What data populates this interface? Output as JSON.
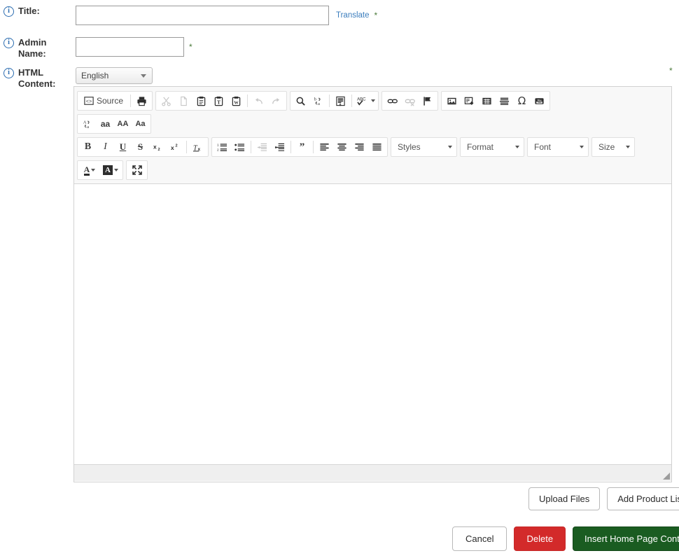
{
  "form": {
    "rows": [
      {
        "id": "title",
        "label": "Title:",
        "icon": "info-icon",
        "value": "",
        "placeholder": "",
        "required_marker": "*",
        "translate_label": "Translate"
      },
      {
        "id": "admin_name",
        "label": "Admin Name:",
        "icon": "info-icon",
        "value": "",
        "placeholder": "",
        "required_marker": "*"
      },
      {
        "id": "html_content",
        "label": "HTML Content:",
        "icon": "info-icon",
        "required_marker": "*"
      }
    ],
    "language_select": {
      "value": "English",
      "options": [
        "English"
      ]
    }
  },
  "editor": {
    "toolbar_rows": [
      {
        "groups": [
          {
            "items": [
              {
                "name": "source-button",
                "icon": "source-icon",
                "label": "Source",
                "disabled": false
              },
              {
                "name": "separator",
                "icon": "separator"
              },
              {
                "name": "print-button",
                "icon": "printer-icon",
                "disabled": false
              }
            ]
          },
          {
            "items": [
              {
                "name": "cut-button",
                "icon": "scissors-icon",
                "disabled": true
              },
              {
                "name": "copy-button",
                "icon": "copy-icon",
                "disabled": true
              },
              {
                "name": "paste-button",
                "icon": "paste-icon",
                "disabled": false
              },
              {
                "name": "paste-as-plain-text-button",
                "icon": "paste-text-icon",
                "disabled": false
              },
              {
                "name": "paste-from-word-button",
                "icon": "paste-word-icon",
                "disabled": false
              },
              {
                "name": "separator",
                "icon": "separator"
              },
              {
                "name": "undo-button",
                "icon": "undo-icon",
                "disabled": true
              },
              {
                "name": "redo-button",
                "icon": "redo-icon",
                "disabled": true
              }
            ]
          },
          {
            "items": [
              {
                "name": "find-button",
                "icon": "magnifier-icon",
                "disabled": false
              },
              {
                "name": "replace-button",
                "icon": "replace-icon",
                "disabled": false
              },
              {
                "name": "separator",
                "icon": "separator"
              },
              {
                "name": "select-all-button",
                "icon": "select-all-icon",
                "disabled": false
              },
              {
                "name": "separator",
                "icon": "separator"
              },
              {
                "name": "spellcheck-button",
                "icon": "spellcheck-icon",
                "label": "ABC",
                "menu": true,
                "disabled": false
              }
            ]
          },
          {
            "items": [
              {
                "name": "link-button",
                "icon": "link-icon",
                "disabled": false
              },
              {
                "name": "unlink-button",
                "icon": "unlink-icon",
                "disabled": true
              },
              {
                "name": "anchor-button",
                "icon": "flag-icon",
                "disabled": false
              }
            ]
          },
          {
            "items": [
              {
                "name": "image-button",
                "icon": "image-icon",
                "disabled": false
              },
              {
                "name": "flash-button",
                "icon": "flash-icon",
                "disabled": false
              },
              {
                "name": "table-button",
                "icon": "table-icon",
                "disabled": false
              },
              {
                "name": "horizontal-rule-button",
                "icon": "hrule-icon",
                "disabled": false
              },
              {
                "name": "special-char-button",
                "icon": "omega-icon",
                "label": "Ω",
                "disabled": false
              },
              {
                "name": "youtube-button",
                "icon": "youtube-icon",
                "disabled": false
              }
            ]
          }
        ]
      },
      {
        "groups": [
          {
            "items": [
              {
                "name": "text-transform-button",
                "icon": "change-case-icon",
                "disabled": false
              },
              {
                "name": "lowercase-button",
                "icon": "lowercase-icon",
                "label": "aa",
                "disabled": false
              },
              {
                "name": "uppercase-button",
                "icon": "uppercase-icon",
                "label": "AA",
                "disabled": false
              },
              {
                "name": "capitalize-button",
                "icon": "capitalize-icon",
                "label": "Aa",
                "disabled": false
              }
            ]
          }
        ]
      },
      {
        "groups": [
          {
            "items": [
              {
                "name": "bold-button",
                "icon": "bold-icon",
                "label": "B",
                "disabled": false
              },
              {
                "name": "italic-button",
                "icon": "italic-icon",
                "label": "I",
                "disabled": false
              },
              {
                "name": "underline-button",
                "icon": "underline-icon",
                "label": "U",
                "disabled": false
              },
              {
                "name": "strikethrough-button",
                "icon": "strikethrough-icon",
                "label": "S",
                "disabled": false
              },
              {
                "name": "subscript-button",
                "icon": "subscript-icon",
                "disabled": false
              },
              {
                "name": "superscript-button",
                "icon": "superscript-icon",
                "disabled": false
              },
              {
                "name": "separator",
                "icon": "separator"
              },
              {
                "name": "remove-format-button",
                "icon": "remove-format-icon",
                "disabled": false
              }
            ]
          },
          {
            "items": [
              {
                "name": "numbered-list-button",
                "icon": "numbered-list-icon",
                "disabled": false
              },
              {
                "name": "bulleted-list-button",
                "icon": "bulleted-list-icon",
                "disabled": false
              },
              {
                "name": "separator",
                "icon": "separator"
              },
              {
                "name": "outdent-button",
                "icon": "outdent-icon",
                "disabled": true
              },
              {
                "name": "indent-button",
                "icon": "indent-icon",
                "disabled": false
              },
              {
                "name": "separator",
                "icon": "separator"
              },
              {
                "name": "blockquote-button",
                "icon": "blockquote-icon",
                "disabled": false
              },
              {
                "name": "separator",
                "icon": "separator"
              },
              {
                "name": "align-left-button",
                "icon": "align-left-icon",
                "disabled": false
              },
              {
                "name": "align-center-button",
                "icon": "align-center-icon",
                "disabled": false
              },
              {
                "name": "align-right-button",
                "icon": "align-right-icon",
                "disabled": false
              },
              {
                "name": "align-justify-button",
                "icon": "align-justify-icon",
                "disabled": false
              }
            ]
          }
        ],
        "combos": [
          {
            "name": "styles-combo",
            "label": "Styles"
          },
          {
            "name": "format-combo",
            "label": "Format"
          },
          {
            "name": "font-combo",
            "label": "Font"
          },
          {
            "name": "size-combo",
            "label": "Size"
          }
        ]
      },
      {
        "groups": [
          {
            "items": [
              {
                "name": "text-color-button",
                "icon": "text-color-icon",
                "label": "A",
                "menu": true,
                "disabled": false
              },
              {
                "name": "background-color-button",
                "icon": "bg-color-icon",
                "label": "A",
                "menu": true,
                "disabled": false
              }
            ]
          },
          {
            "items": [
              {
                "name": "maximize-button",
                "icon": "maximize-icon",
                "disabled": false
              }
            ]
          }
        ]
      }
    ],
    "content": ""
  },
  "actions": {
    "upload_files": "Upload Files",
    "add_product_list": "Add Product List",
    "cancel": "Cancel",
    "delete": "Delete",
    "submit": "Insert Home Page Content"
  },
  "colors": {
    "info_icon": "#2b6cb0",
    "link": "#3b7dbd",
    "required_star": "#4a7a3a",
    "danger": "#d32a2a",
    "success": "#1a5c21",
    "toolbar_bg": "#f8f8f8",
    "editor_border": "#d1d1d1"
  }
}
